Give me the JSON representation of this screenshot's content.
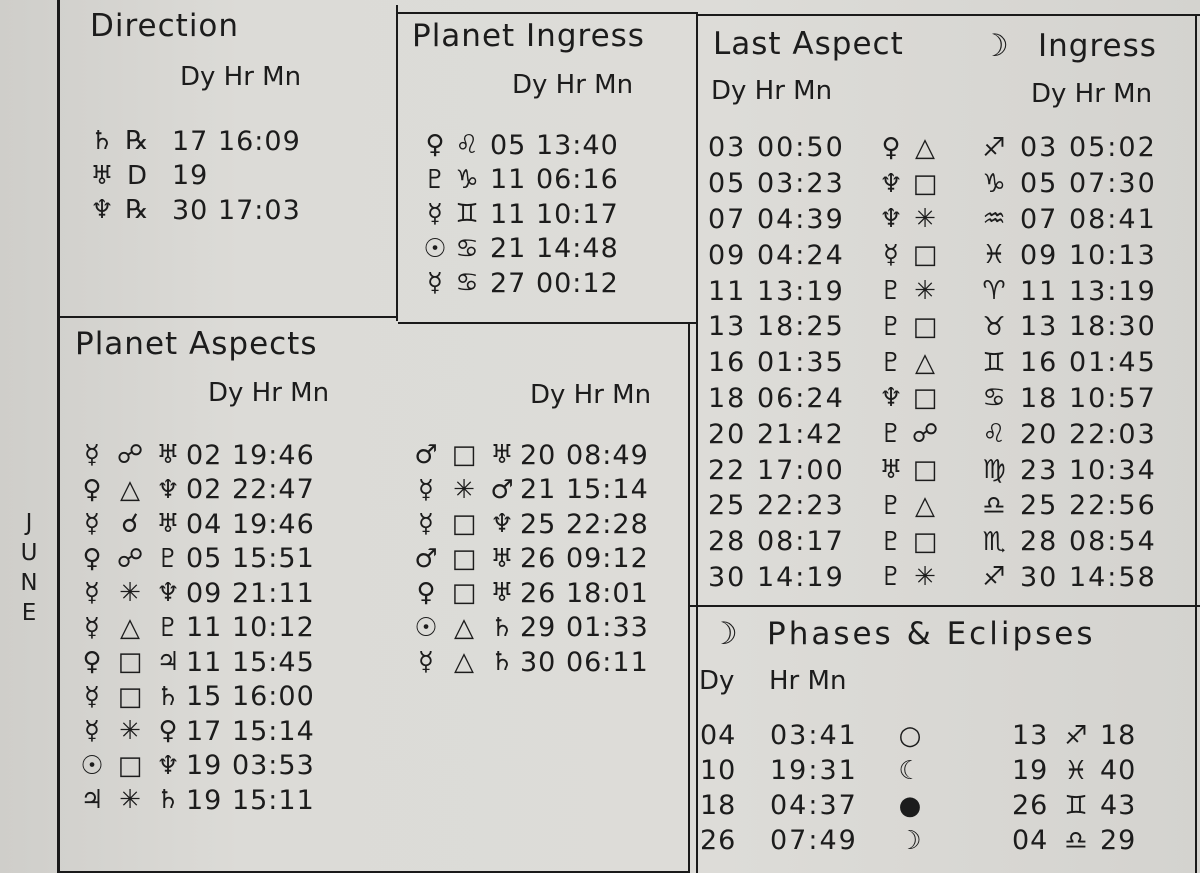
{
  "month": "JUNE",
  "direction": {
    "title": "Direction",
    "header": "Dy Hr Mn",
    "rows": [
      {
        "planet": "♄",
        "planet_name": "saturn",
        "status": "℞",
        "status_name": "retrograde",
        "time": "17 16:09"
      },
      {
        "planet": "♅",
        "planet_name": "uranus",
        "status": "D",
        "status_name": "direct",
        "time": "19"
      },
      {
        "planet": "♆",
        "planet_name": "neptune",
        "status": "℞",
        "status_name": "retrograde",
        "time": "30 17:03"
      }
    ]
  },
  "planet_ingress": {
    "title": "Planet Ingress",
    "header": "Dy Hr Mn",
    "rows": [
      {
        "planet": "♀",
        "planet_name": "venus",
        "sign": "♌",
        "sign_name": "leo",
        "time": "05 13:40"
      },
      {
        "planet": "♇",
        "planet_name": "pluto",
        "sign": "♑",
        "sign_name": "capricorn",
        "time": "11 06:16"
      },
      {
        "planet": "☿",
        "planet_name": "mercury",
        "sign": "♊",
        "sign_name": "gemini",
        "time": "11 10:17"
      },
      {
        "planet": "☉",
        "planet_name": "sun",
        "sign": "♋",
        "sign_name": "cancer",
        "time": "21 14:48"
      },
      {
        "planet": "☿",
        "planet_name": "mercury",
        "sign": "♋",
        "sign_name": "cancer",
        "time": "27 00:12"
      }
    ]
  },
  "last_aspect": {
    "title": "Last Aspect",
    "header": "Dy Hr Mn",
    "rows": [
      {
        "time": "03 00:50",
        "planet": "♀",
        "aspect": "△"
      },
      {
        "time": "05 03:23",
        "planet": "♆",
        "aspect": "□"
      },
      {
        "time": "07 04:39",
        "planet": "♆",
        "aspect": "✳"
      },
      {
        "time": "09 04:24",
        "planet": "☿",
        "aspect": "□"
      },
      {
        "time": "11 13:19",
        "planet": "♇",
        "aspect": "✳"
      },
      {
        "time": "13 18:25",
        "planet": "♇",
        "aspect": "□"
      },
      {
        "time": "16 01:35",
        "planet": "♇",
        "aspect": "△"
      },
      {
        "time": "18 06:24",
        "planet": "♆",
        "aspect": "□"
      },
      {
        "time": "20 21:42",
        "planet": "♇",
        "aspect": "☍"
      },
      {
        "time": "22 17:00",
        "planet": "♅",
        "aspect": "□"
      },
      {
        "time": "25 22:23",
        "planet": "♇",
        "aspect": "△"
      },
      {
        "time": "28 08:17",
        "planet": "♇",
        "aspect": "□"
      },
      {
        "time": "30 14:19",
        "planet": "♇",
        "aspect": "✳"
      }
    ]
  },
  "moon_ingress": {
    "moon_symbol": "☽",
    "title": "Ingress",
    "header": "Dy Hr Mn",
    "rows": [
      {
        "sign": "♐",
        "time": "03 05:02"
      },
      {
        "sign": "♑",
        "time": "05 07:30"
      },
      {
        "sign": "♒",
        "time": "07 08:41"
      },
      {
        "sign": "♓",
        "time": "09 10:13"
      },
      {
        "sign": "♈",
        "time": "11 13:19"
      },
      {
        "sign": "♉",
        "time": "13 18:30"
      },
      {
        "sign": "♊",
        "time": "16 01:45"
      },
      {
        "sign": "♋",
        "time": "18 10:57"
      },
      {
        "sign": "♌",
        "time": "20 22:03"
      },
      {
        "sign": "♍",
        "time": "23 10:34"
      },
      {
        "sign": "♎",
        "time": "25 22:56"
      },
      {
        "sign": "♏",
        "time": "28 08:54"
      },
      {
        "sign": "♐",
        "time": "30 14:58"
      }
    ]
  },
  "planet_aspects": {
    "title": "Planet Aspects",
    "header": "Dy Hr Mn",
    "left": [
      {
        "p1": "☿",
        "aspect": "☍",
        "p2": "♅",
        "time": "02 19:46"
      },
      {
        "p1": "♀",
        "aspect": "△",
        "p2": "♆",
        "time": "02 22:47"
      },
      {
        "p1": "☿",
        "aspect": "☌",
        "p2": "♅",
        "time": "04 19:46"
      },
      {
        "p1": "♀",
        "aspect": "☍",
        "p2": "♇",
        "time": "05 15:51"
      },
      {
        "p1": "☿",
        "aspect": "✳",
        "p2": "♆",
        "time": "09 21:11"
      },
      {
        "p1": "☿",
        "aspect": "△",
        "p2": "♇",
        "time": "11 10:12"
      },
      {
        "p1": "♀",
        "aspect": "□",
        "p2": "♃",
        "time": "11 15:45"
      },
      {
        "p1": "☿",
        "aspect": "□",
        "p2": "♄",
        "time": "15 16:00"
      },
      {
        "p1": "☿",
        "aspect": "✳",
        "p2": "♀",
        "time": "17 15:14"
      },
      {
        "p1": "☉",
        "aspect": "□",
        "p2": "♆",
        "time": "19 03:53"
      },
      {
        "p1": "♃",
        "aspect": "✳",
        "p2": "♄",
        "time": "19 15:11"
      }
    ],
    "right": [
      {
        "p1": "♂",
        "aspect": "□",
        "p2": "♅",
        "time": "20 08:49"
      },
      {
        "p1": "☿",
        "aspect": "✳",
        "p2": "♂",
        "time": "21 15:14"
      },
      {
        "p1": "☿",
        "aspect": "□",
        "p2": "♆",
        "time": "25 22:28"
      },
      {
        "p1": "♂",
        "aspect": "□",
        "p2": "♅",
        "time": "26 09:12"
      },
      {
        "p1": "♀",
        "aspect": "□",
        "p2": "♅",
        "time": "26 18:01"
      },
      {
        "p1": "☉",
        "aspect": "△",
        "p2": "♄",
        "time": "29 01:33"
      },
      {
        "p1": "☿",
        "aspect": "△",
        "p2": "♄",
        "time": "30 06:11"
      }
    ]
  },
  "phases": {
    "moon_symbol": "☽",
    "title": "Phases & Eclipses",
    "header_dy": "Dy",
    "header_hrmn": "Hr Mn",
    "rows": [
      {
        "dy": "04",
        "hrmn": "03:41",
        "phase": "○",
        "phase_name": "full-moon",
        "pos_deg": "13",
        "pos_sign": "♐",
        "pos_min": "18"
      },
      {
        "dy": "10",
        "hrmn": "19:31",
        "phase": "☾",
        "phase_name": "last-quarter",
        "pos_deg": "19",
        "pos_sign": "♓",
        "pos_min": "40"
      },
      {
        "dy": "18",
        "hrmn": "04:37",
        "phase": "●",
        "phase_name": "new-moon",
        "pos_deg": "26",
        "pos_sign": "♊",
        "pos_min": "43"
      },
      {
        "dy": "26",
        "hrmn": "07:49",
        "phase": "☽",
        "phase_name": "first-quarter",
        "pos_deg": "04",
        "pos_sign": "♎",
        "pos_min": "29"
      }
    ]
  }
}
